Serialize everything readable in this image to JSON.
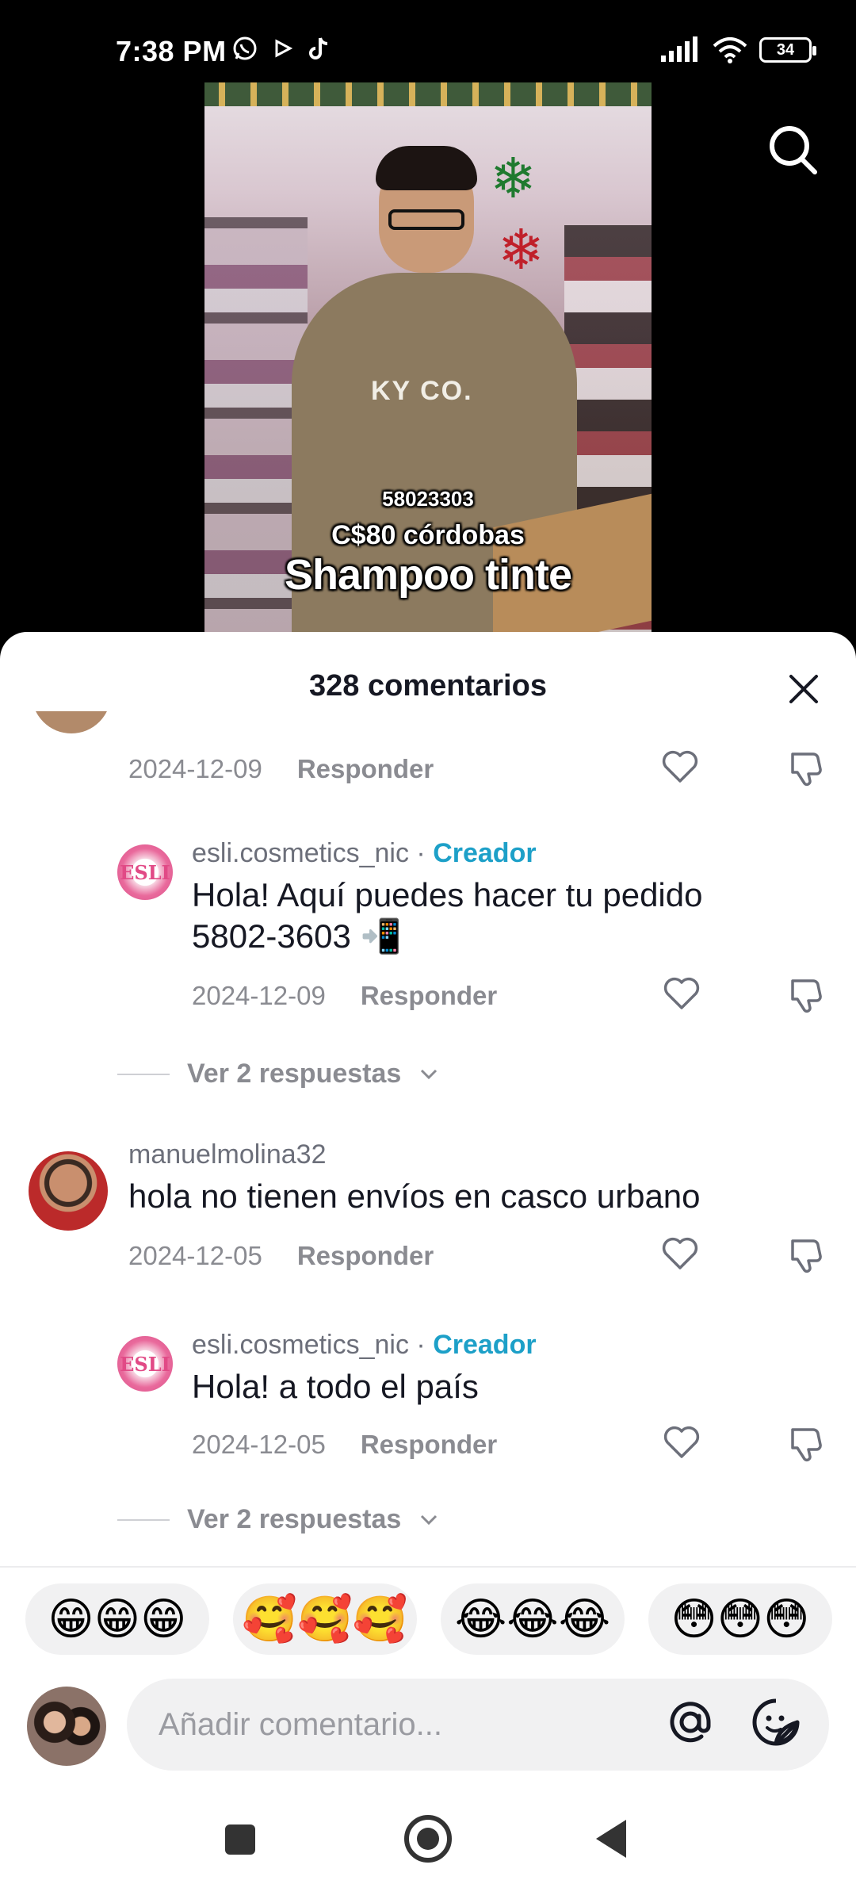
{
  "status_bar": {
    "time": "7:38 PM",
    "battery": "34",
    "icons": [
      "whatsapp-icon",
      "play-icon",
      "tiktok-icon",
      "signal-icon",
      "wifi-icon",
      "battery-icon"
    ]
  },
  "video": {
    "caption_phone": "58023303",
    "caption_price": "C$80 córdobas",
    "caption_title": "Shampoo tinte",
    "shirt_text": "KY CO."
  },
  "comments": {
    "title": "328 comentarios",
    "reply_label": "Responder",
    "items": [
      {
        "date": "2024-12-09"
      },
      {
        "username": "esli.cosmetics_nic",
        "separator": " · ",
        "badge": "Creador",
        "text": "Hola! Aquí puedes hacer tu pedido 5802-3603 📲",
        "date": "2024-12-09"
      },
      {
        "view_replies": "Ver 2 respuestas"
      },
      {
        "username": "manuelmolina32",
        "text": "hola no tienen envíos en casco urbano",
        "date": "2024-12-05"
      },
      {
        "username": "esli.cosmetics_nic",
        "separator": " · ",
        "badge": "Creador",
        "text": "Hola! a todo el país",
        "date": "2024-12-05"
      },
      {
        "view_replies": "Ver 2 respuestas"
      }
    ]
  },
  "emoji_bar": [
    "😁😁😁",
    "🥰🥰🥰",
    "😂😂😂",
    "😳😳😳"
  ],
  "composer": {
    "placeholder": "Añadir comentario..."
  },
  "colors": {
    "creator": "#1da0c8",
    "text": "#161823",
    "muted": "#8a8b91"
  }
}
